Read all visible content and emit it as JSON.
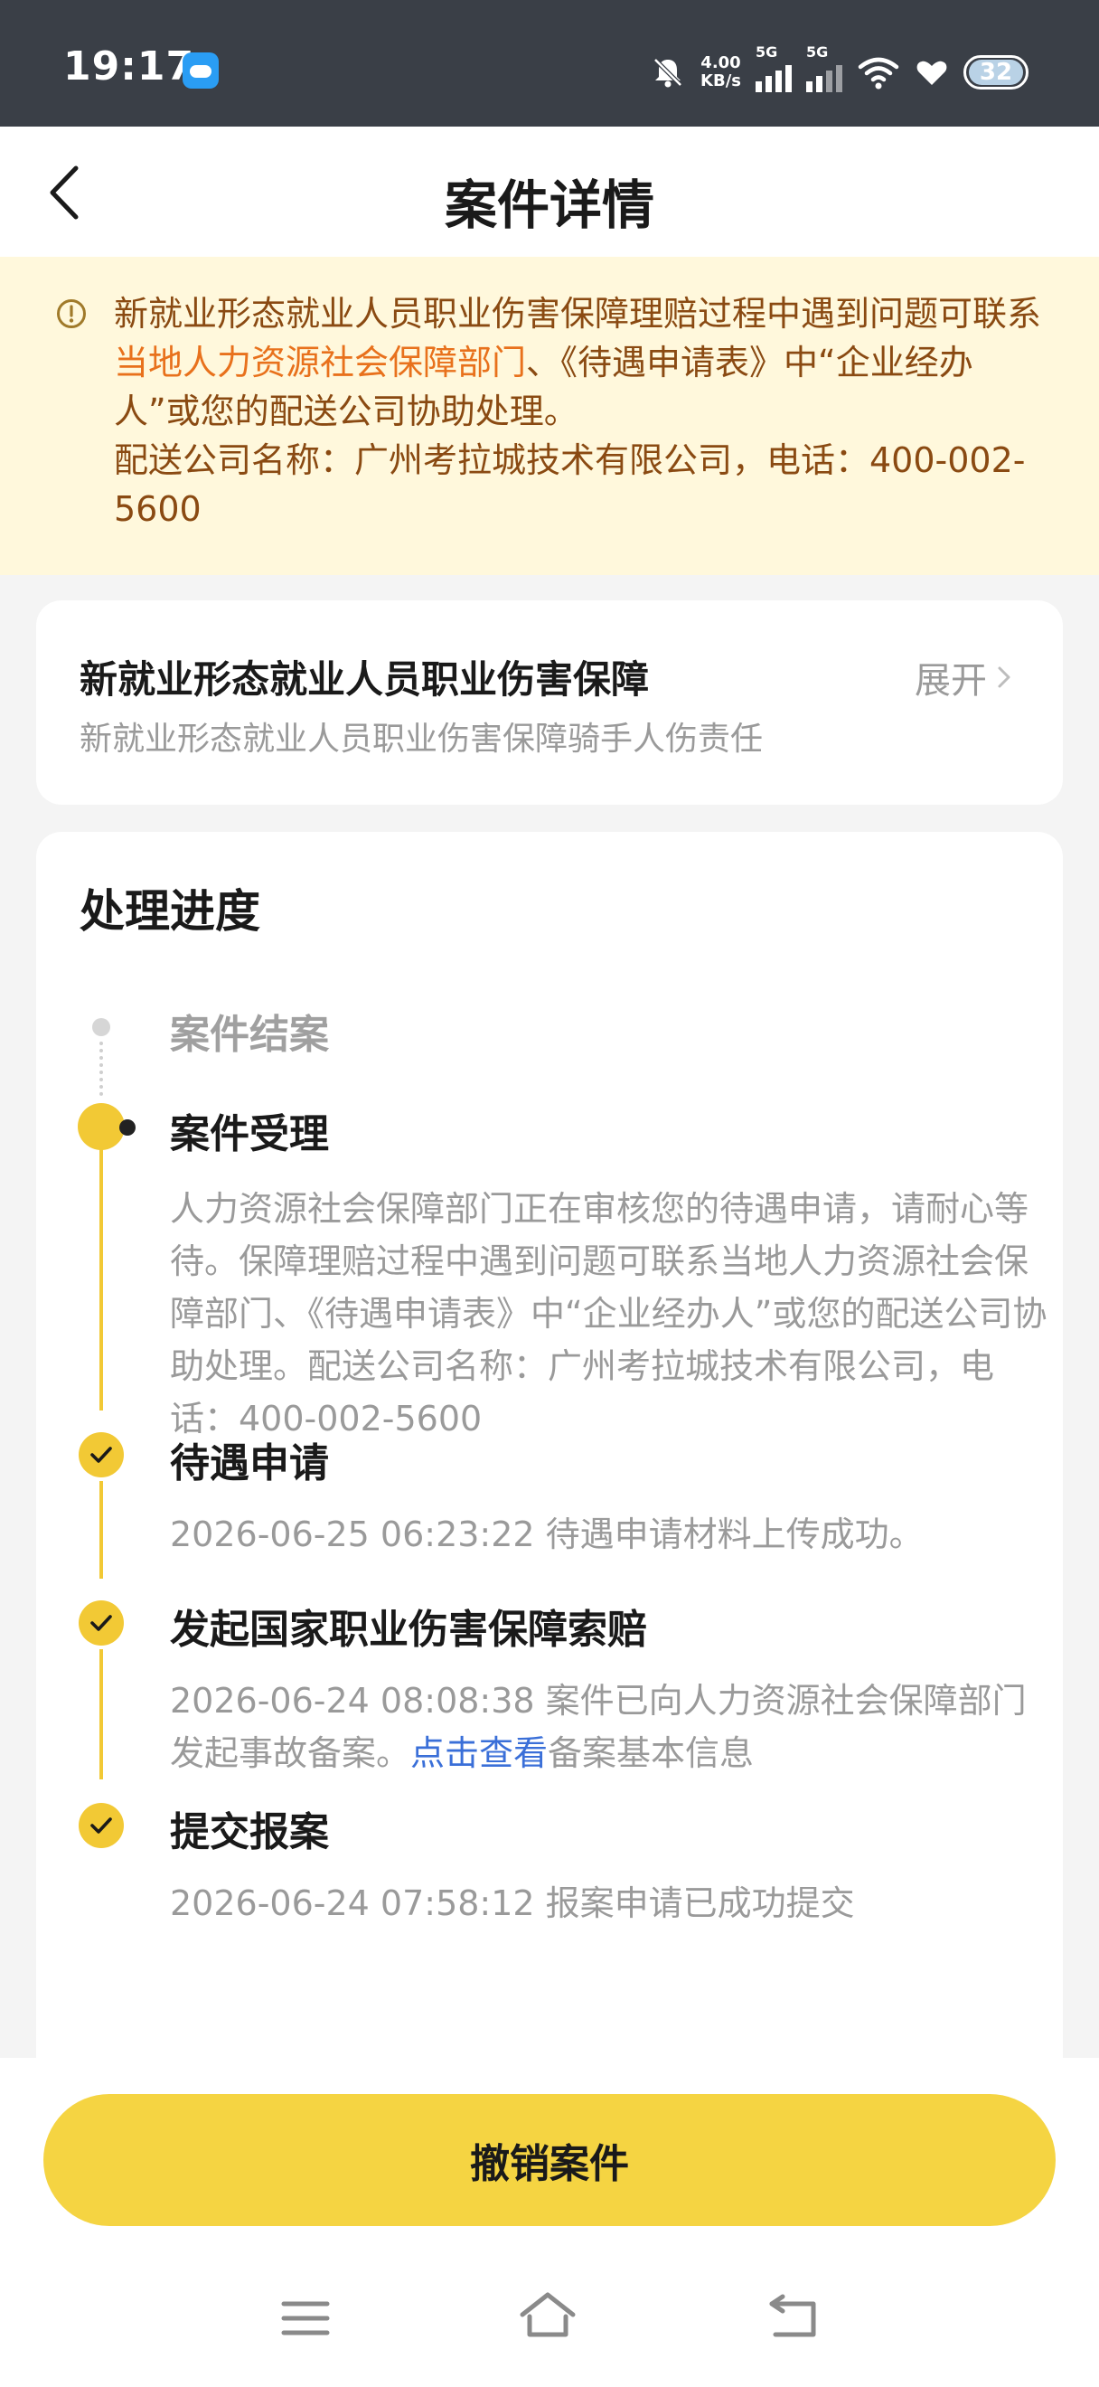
{
  "status_bar": {
    "time": "19:17",
    "net_speed_value": "4.00",
    "net_speed_unit": "KB/s",
    "signal1_label": "5G",
    "signal2_label": "5G",
    "battery": "32"
  },
  "header": {
    "title": "案件详情"
  },
  "notice": {
    "text_part1": "新就业形态就业人员职业伤害保障理赔过程中遇到问题可联系",
    "link_text": "当地人力资源社会保障部门",
    "text_part2": "、《待遇申请表》中“企业经办人”或您的配送公司协助处理。",
    "company_line": "配送公司名称：广州考拉城技术有限公司，电话：400-002-5600"
  },
  "plan_card": {
    "title": "新就业形态就业人员职业伤害保障",
    "subtitle": "新就业形态就业人员职业伤害保障骑手人伤责任",
    "expand_label": "展开"
  },
  "progress": {
    "section_title": "处理进度",
    "steps": [
      {
        "title": "案件结案",
        "status": "pending"
      },
      {
        "title": "案件受理",
        "status": "current",
        "desc": "人力资源社会保障部门正在审核您的待遇申请，请耐心等待。保障理赔过程中遇到问题可联系当地人力资源社会保障部门、《待遇申请表》中“企业经办人”或您的配送公司协助处理。配送公司名称：广州考拉城技术有限公司，电话：400-002-5600"
      },
      {
        "title": "待遇申请",
        "status": "done",
        "desc": "2026-06-25 06:23:22 待遇申请材料上传成功。"
      },
      {
        "title": "发起国家职业伤害保障索赔",
        "status": "done",
        "desc_part1": "2026-06-24 08:08:38 案件已向人力资源社会保障部门发起事故备案。",
        "link_text": "点击查看",
        "desc_part2": "备案基本信息"
      },
      {
        "title": "提交报案",
        "status": "done",
        "desc": "2026-06-24 07:58:12 报案申请已成功提交"
      }
    ]
  },
  "bottom": {
    "cancel_label": "撤销案件"
  },
  "colors": {
    "accent_yellow": "#f2c935",
    "button_yellow": "#f5d442",
    "notice_bg": "#fff8dc",
    "notice_text": "#8a4a12",
    "notice_link": "#e8711c",
    "link_blue": "#3a6fd8"
  },
  "icons": {
    "back": "chevron-left-icon",
    "notice": "info-circle-icon",
    "expand": "chevron-right-icon",
    "check": "check-icon"
  }
}
